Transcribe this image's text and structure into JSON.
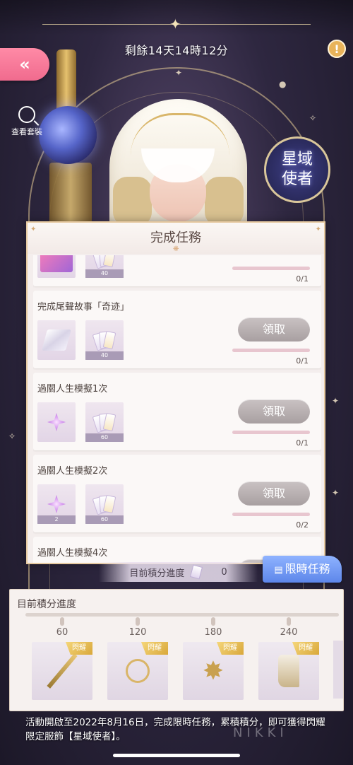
{
  "header": {
    "time_remaining": "剩餘14天14時12分",
    "info_icon": "exclamation-icon",
    "back_icon": "double-chevron-left-icon"
  },
  "side": {
    "view_outfit_label": "查看套裝",
    "emblem_line1": "星域",
    "emblem_line2": "使者"
  },
  "task_panel": {
    "title": "完成任務",
    "tasks": [
      {
        "name": "",
        "rewards": [
          {
            "type": "pink-card-icon",
            "qty": ""
          },
          {
            "type": "ticket-icon",
            "qty": "40"
          }
        ],
        "claim_label": "",
        "progress": "0/1"
      },
      {
        "name": "完成尾聲故事「奇迹」",
        "rewards": [
          {
            "type": "silk-icon",
            "qty": ""
          },
          {
            "type": "ticket-icon",
            "qty": "40"
          }
        ],
        "claim_label": "領取",
        "progress": "0/1"
      },
      {
        "name": "過關人生模擬1次",
        "rewards": [
          {
            "type": "star-gem-icon",
            "qty": ""
          },
          {
            "type": "ticket-icon",
            "qty": "60"
          }
        ],
        "claim_label": "領取",
        "progress": "0/1"
      },
      {
        "name": "過關人生模擬2次",
        "rewards": [
          {
            "type": "star-gem-icon",
            "qty": "2"
          },
          {
            "type": "ticket-icon",
            "qty": "60"
          }
        ],
        "claim_label": "領取",
        "progress": "0/2"
      },
      {
        "name": "過關人生模擬4次",
        "rewards": [],
        "claim_label": "",
        "progress": ""
      }
    ]
  },
  "score": {
    "label": "目前積分進度",
    "value": "0"
  },
  "limited_task_button": "限時任務",
  "reward_progress": {
    "title": "目前積分進度",
    "milestones": [
      {
        "value": "60",
        "tag": "閃耀",
        "item": "wand-icon"
      },
      {
        "value": "120",
        "tag": "閃耀",
        "item": "earring-icon"
      },
      {
        "value": "180",
        "tag": "閃耀",
        "item": "star-ornament-icon"
      },
      {
        "value": "240",
        "tag": "閃耀",
        "item": "boots-icon"
      }
    ]
  },
  "event_description": "活動開啟至2022年8月16日，完成限時任務，累積積分，即可獲得閃耀限定服飾【星域使者】。",
  "watermark": "NIKKI",
  "colors": {
    "accent_pink": "#f06b8e",
    "accent_blue": "#5d86ea",
    "gold": "#d9b568"
  }
}
